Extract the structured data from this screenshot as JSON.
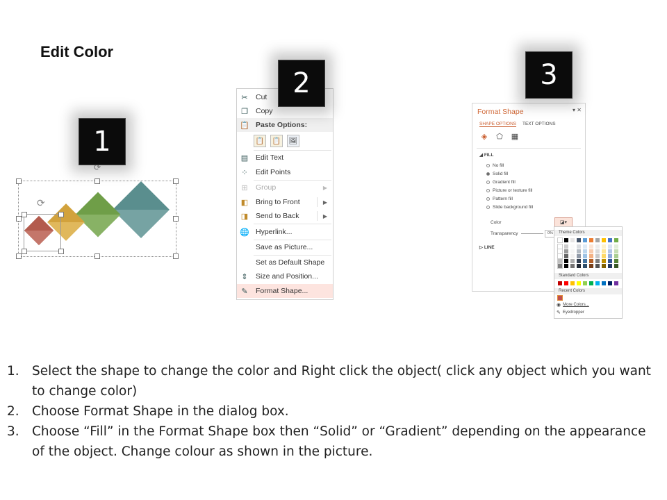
{
  "title": "Edit Color",
  "badges": [
    "1",
    "2",
    "3"
  ],
  "context_menu": {
    "items": [
      {
        "label": "Cut",
        "icon": "scissors-icon",
        "state": "normal"
      },
      {
        "label": "Copy",
        "icon": "copy-icon",
        "state": "normal"
      },
      {
        "label": "Paste Options:",
        "icon": "paste-icon",
        "state": "header"
      },
      {
        "label": "Edit Text",
        "icon": "edit-text-icon",
        "state": "normal"
      },
      {
        "label": "Edit Points",
        "icon": "edit-points-icon",
        "state": "normal"
      },
      {
        "label": "Group",
        "icon": "group-icon",
        "state": "disabled"
      },
      {
        "label": "Bring to Front",
        "icon": "bring-front-icon",
        "state": "normal"
      },
      {
        "label": "Send to Back",
        "icon": "send-back-icon",
        "state": "normal"
      },
      {
        "label": "Hyperlink...",
        "icon": "hyperlink-icon",
        "state": "normal"
      },
      {
        "label": "Save as Picture...",
        "icon": "",
        "state": "normal"
      },
      {
        "label": "Set as Default Shape",
        "icon": "",
        "state": "normal"
      },
      {
        "label": "Size and Position...",
        "icon": "size-position-icon",
        "state": "normal"
      },
      {
        "label": "Format Shape...",
        "icon": "format-shape-icon",
        "state": "highlighted"
      }
    ]
  },
  "format_panel": {
    "title": "Format Shape",
    "controls": "▾ ✕",
    "tabs": [
      "SHAPE OPTIONS",
      "TEXT OPTIONS"
    ],
    "fill_section": "FILL",
    "fill_options": [
      {
        "label": "No fill",
        "selected": false
      },
      {
        "label": "Solid fill",
        "selected": true
      },
      {
        "label": "Gradient fill",
        "selected": false
      },
      {
        "label": "Picture or texture fill",
        "selected": false
      },
      {
        "label": "Pattern fill",
        "selected": false
      },
      {
        "label": "Slide background fill",
        "selected": false
      }
    ],
    "color_label": "Color",
    "transparency_label": "Transparency",
    "transparency_value": "0%",
    "line_section": "LINE"
  },
  "color_picker": {
    "theme_label": "Theme Colors",
    "standard_label": "Standard Colors",
    "recent_label": "Recent Colors",
    "more_colors": "More Colors...",
    "eyedropper": "Eyedropper",
    "theme_top": [
      "#ffffff",
      "#000000",
      "#e7e6e6",
      "#44546a",
      "#5b9bd5",
      "#ed7d31",
      "#a5a5a5",
      "#ffc000",
      "#4472c4",
      "#70ad47"
    ],
    "standard": [
      "#c00000",
      "#ff0000",
      "#ffc000",
      "#ffff00",
      "#92d050",
      "#00b050",
      "#00b0f0",
      "#0070c0",
      "#002060",
      "#7030a0"
    ],
    "recent": [
      "#c0504d"
    ]
  },
  "diamonds": [
    {
      "color": "#b35b4d"
    },
    {
      "color": "#d2a23c"
    },
    {
      "color": "#6f9e48"
    },
    {
      "color": "#5a8e8e"
    }
  ],
  "instructions": [
    {
      "num": "1.",
      "text": "Select the shape to change the color and Right click the object( click any object which you want to change color)"
    },
    {
      "num": "2.",
      "text": "Choose Format Shape in the dialog box."
    },
    {
      "num": "3.",
      "text": "Choose “Fill” in the Format Shape box then “Solid” or “Gradient” depending on the appearance of the object. Change colour as shown in the picture."
    }
  ]
}
